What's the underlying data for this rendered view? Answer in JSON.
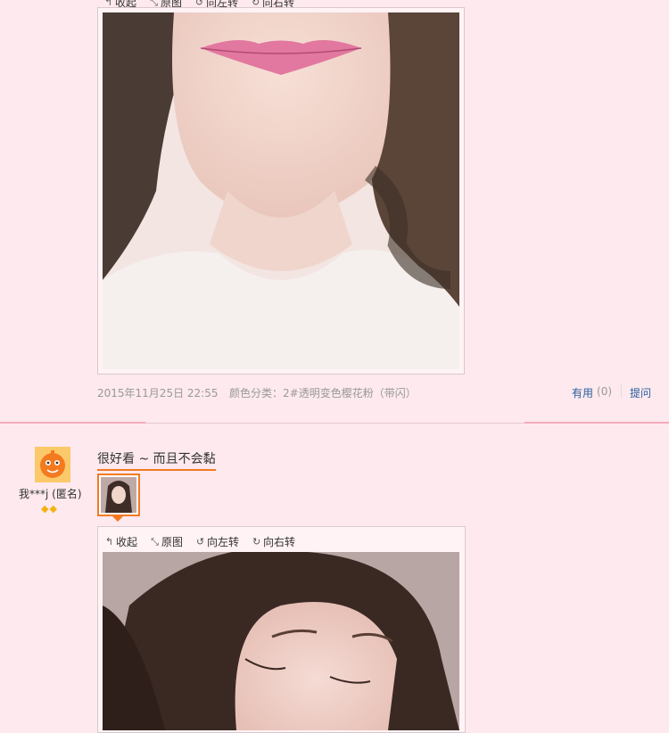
{
  "review1": {
    "toolbar": {
      "collapse": "收起",
      "original": "原图",
      "rotate_left": "向左转",
      "rotate_right": "向右转"
    },
    "date": "2015年11月25日 22:55",
    "color_label": "颜色分类：2#透明变色樱花粉（带闪）",
    "useful_label": "有用",
    "useful_count": "(0)",
    "ask_label": "提问"
  },
  "review2": {
    "user_name": "我***j (匿名)",
    "comment": "很好看 ~ 而且不会黏",
    "toolbar": {
      "collapse": "收起",
      "original": "原图",
      "rotate_left": "向左转",
      "rotate_right": "向右转"
    }
  },
  "colors": {
    "background": "#fde9ee",
    "accent": "#f5a9bb",
    "link": "#2a5f9e",
    "avatar": "#f39c1f"
  },
  "icons": [
    "collapse-icon",
    "expand-icon",
    "rotate-left-icon",
    "rotate-right-icon",
    "diamond-icon"
  ]
}
